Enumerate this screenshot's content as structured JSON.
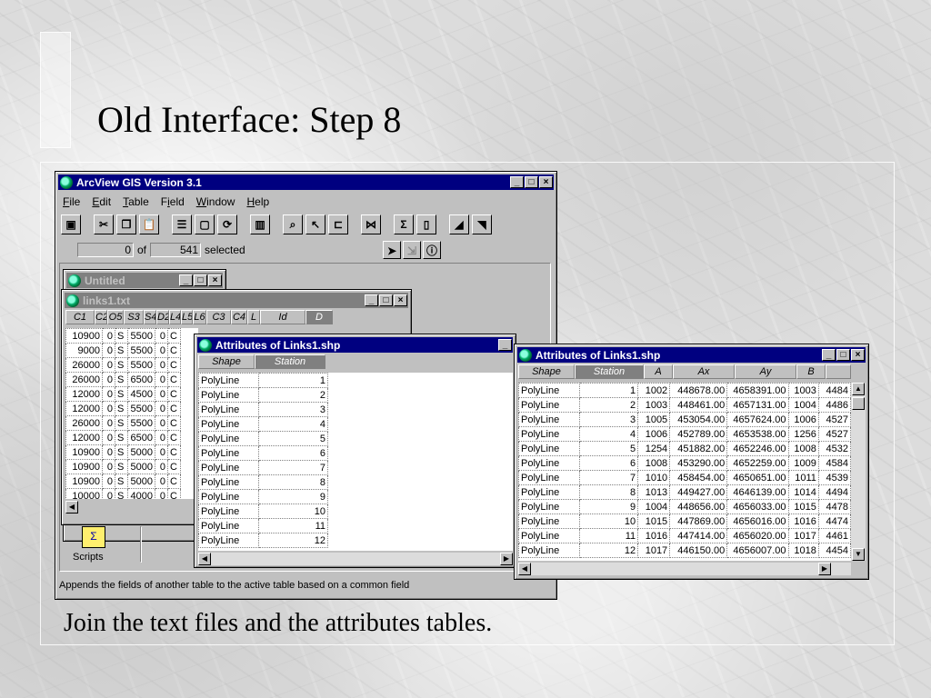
{
  "slide": {
    "title": "Old Interface: Step 8",
    "caption": "Join the text files and the attributes tables."
  },
  "app": {
    "title": "ArcView GIS Version 3.1",
    "menu": [
      "File",
      "Edit",
      "Table",
      "Field",
      "Window",
      "Help"
    ],
    "menu_underline": [
      "F",
      "E",
      "T",
      "i",
      "W",
      "H"
    ],
    "selection": {
      "count": "0",
      "of_label": "of",
      "total": "541",
      "suffix": "selected"
    },
    "status_text": "Appends the fields of another table to the active table based on a common field",
    "scripts_label": "Scripts"
  },
  "toolbar_icons": [
    "save-icon",
    "cut-icon",
    "copy-icon",
    "paste-icon",
    "table-properties-icon",
    "table-icon",
    "refresh-icon",
    "chart-icon",
    "find-icon",
    "query-icon",
    "select-all-icon",
    "join-icon",
    "statistics-icon",
    "summarize-icon",
    "sort-ascending-icon",
    "sort-descending-icon"
  ],
  "untitled_window": {
    "title": "Untitled"
  },
  "links_txt": {
    "title": "links1.txt",
    "columns": [
      "C1",
      "C2",
      "O5",
      "S3",
      "S4",
      "D2",
      "L4",
      "L5",
      "L6",
      "C3",
      "C4",
      "L",
      "Id",
      "D"
    ],
    "rows": [
      [
        "10900",
        "0",
        "S",
        "5500",
        "0",
        "C"
      ],
      [
        "9000",
        "0",
        "S",
        "5500",
        "0",
        "C"
      ],
      [
        "26000",
        "0",
        "S",
        "5500",
        "0",
        "C"
      ],
      [
        "26000",
        "0",
        "S",
        "6500",
        "0",
        "C"
      ],
      [
        "12000",
        "0",
        "S",
        "4500",
        "0",
        "C"
      ],
      [
        "12000",
        "0",
        "S",
        "5500",
        "0",
        "C"
      ],
      [
        "26000",
        "0",
        "S",
        "5500",
        "0",
        "C"
      ],
      [
        "12000",
        "0",
        "S",
        "6500",
        "0",
        "C"
      ],
      [
        "10900",
        "0",
        "S",
        "5000",
        "0",
        "C"
      ],
      [
        "10900",
        "0",
        "S",
        "5000",
        "0",
        "C"
      ],
      [
        "10900",
        "0",
        "S",
        "5000",
        "0",
        "C"
      ],
      [
        "10000",
        "0",
        "S",
        "4000",
        "0",
        "C"
      ]
    ]
  },
  "attr_small": {
    "title": "Attributes of Links1.shp",
    "columns": [
      "Shape",
      "Station"
    ],
    "rows": [
      [
        "PolyLine",
        "1"
      ],
      [
        "PolyLine",
        "2"
      ],
      [
        "PolyLine",
        "3"
      ],
      [
        "PolyLine",
        "4"
      ],
      [
        "PolyLine",
        "5"
      ],
      [
        "PolyLine",
        "6"
      ],
      [
        "PolyLine",
        "7"
      ],
      [
        "PolyLine",
        "8"
      ],
      [
        "PolyLine",
        "9"
      ],
      [
        "PolyLine",
        "10"
      ],
      [
        "PolyLine",
        "11"
      ],
      [
        "PolyLine",
        "12"
      ]
    ]
  },
  "attr_large": {
    "title": "Attributes of Links1.shp",
    "columns": [
      "Shape",
      "Station",
      "A",
      "Ax",
      "Ay",
      "B",
      ""
    ],
    "rows": [
      [
        "PolyLine",
        "1",
        "1002",
        "448678.00",
        "4658391.00",
        "1003",
        "4484"
      ],
      [
        "PolyLine",
        "2",
        "1003",
        "448461.00",
        "4657131.00",
        "1004",
        "4486"
      ],
      [
        "PolyLine",
        "3",
        "1005",
        "453054.00",
        "4657624.00",
        "1006",
        "4527"
      ],
      [
        "PolyLine",
        "4",
        "1006",
        "452789.00",
        "4653538.00",
        "1256",
        "4527"
      ],
      [
        "PolyLine",
        "5",
        "1254",
        "451882.00",
        "4652246.00",
        "1008",
        "4532"
      ],
      [
        "PolyLine",
        "6",
        "1008",
        "453290.00",
        "4652259.00",
        "1009",
        "4584"
      ],
      [
        "PolyLine",
        "7",
        "1010",
        "458454.00",
        "4650651.00",
        "1011",
        "4539"
      ],
      [
        "PolyLine",
        "8",
        "1013",
        "449427.00",
        "4646139.00",
        "1014",
        "4494"
      ],
      [
        "PolyLine",
        "9",
        "1004",
        "448656.00",
        "4656033.00",
        "1015",
        "4478"
      ],
      [
        "PolyLine",
        "10",
        "1015",
        "447869.00",
        "4656016.00",
        "1016",
        "4474"
      ],
      [
        "PolyLine",
        "11",
        "1016",
        "447414.00",
        "4656020.00",
        "1017",
        "4461"
      ],
      [
        "PolyLine",
        "12",
        "1017",
        "446150.00",
        "4656007.00",
        "1018",
        "4454"
      ]
    ]
  }
}
